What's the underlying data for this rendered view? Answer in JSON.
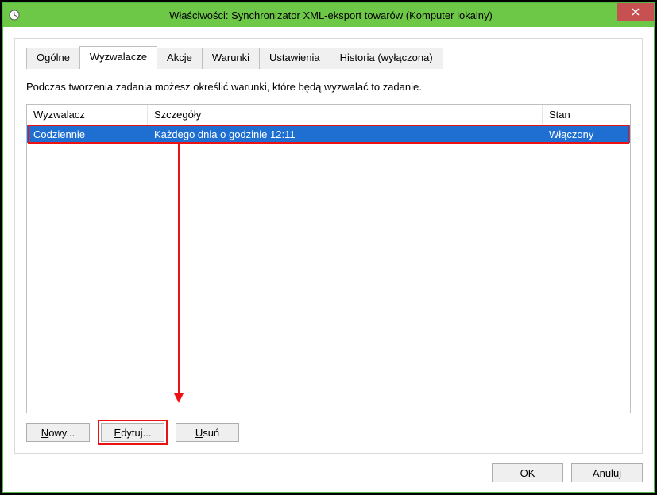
{
  "window": {
    "title": "Właściwości: Synchronizator XML-eksport towarów (Komputer lokalny)"
  },
  "tabs": {
    "general": "Ogólne",
    "triggers": "Wyzwalacze",
    "actions": "Akcje",
    "conditions": "Warunki",
    "settings": "Ustawienia",
    "history": "Historia (wyłączona)"
  },
  "instructions": "Podczas tworzenia zadania możesz określić warunki, które będą wyzwalać to zadanie.",
  "columns": {
    "trigger": "Wyzwalacz",
    "details": "Szczegóły",
    "state": "Stan"
  },
  "rows": [
    {
      "trigger": "Codziennie",
      "details": "Każdego dnia o godzinie 12:11",
      "state": "Włączony"
    }
  ],
  "buttons": {
    "new_prefix": "N",
    "new_rest": "owy...",
    "edit_prefix": "E",
    "edit_rest": "dytuj...",
    "delete_prefix": "U",
    "delete_rest": "suń",
    "ok": "OK",
    "cancel": "Anuluj"
  }
}
